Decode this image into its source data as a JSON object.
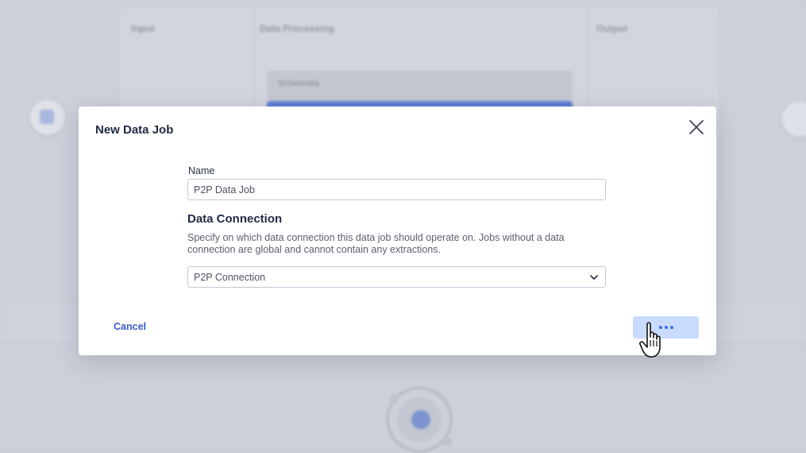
{
  "background": {
    "columns": [
      "Input",
      "Data Processing",
      "Output"
    ],
    "card_label": "Schemata"
  },
  "dialog": {
    "title": "New Data Job",
    "name_label": "Name",
    "name_value": "P2P Data Job",
    "section_heading": "Data Connection",
    "section_description": "Specify on which data connection this data job should operate on. Jobs without a data connection are global and cannot contain any extractions.",
    "connection_selected": "P2P Connection",
    "cancel_label": "Cancel",
    "save_state": "loading"
  },
  "icons": {
    "close": "close-icon",
    "dropdown": "chevron-down-icon",
    "loading": "loading-dots-icon",
    "cursor": "hand-pointer-icon"
  },
  "colors": {
    "accent": "#3e6de0",
    "button_loading_bg": "#c9dcff",
    "title": "#1f2a44",
    "link": "#3a5bc7"
  }
}
